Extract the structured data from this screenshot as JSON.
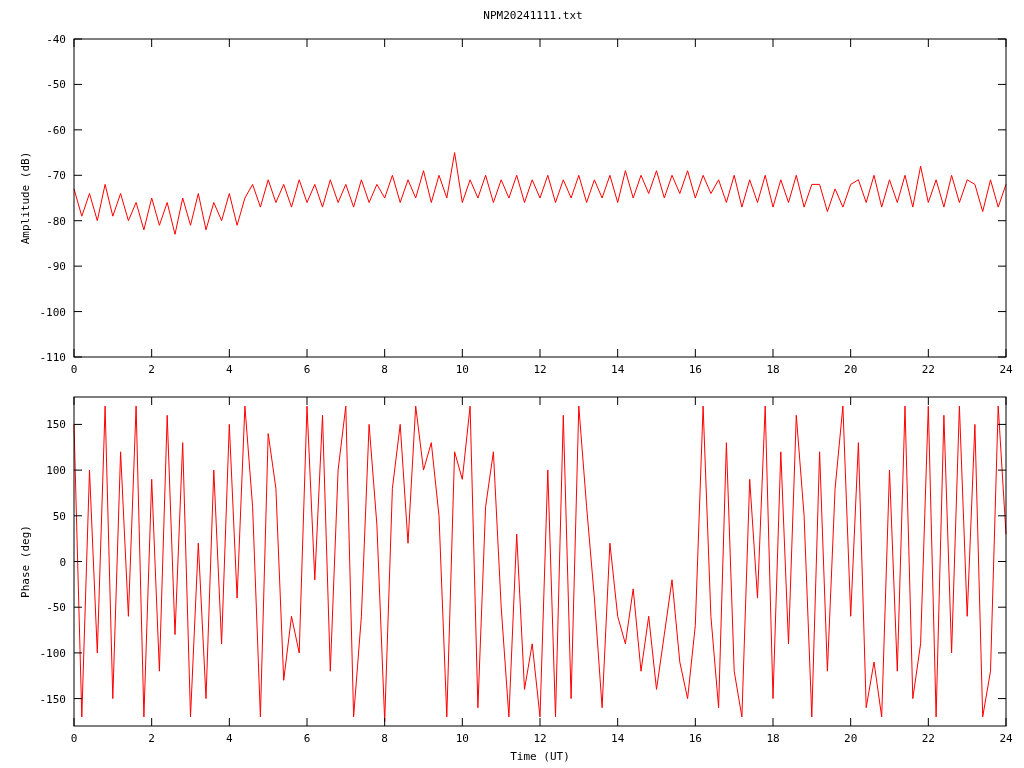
{
  "title": "NPM20241111.txt",
  "amplitude_plot": {
    "chart_data": {
      "type": "line",
      "ylabel": "Amplitude (dB)",
      "xlim": [
        0,
        24
      ],
      "ylim": [
        -110,
        -40
      ],
      "xticks": [
        0,
        2,
        4,
        6,
        8,
        10,
        12,
        14,
        16,
        18,
        20,
        22,
        24
      ],
      "yticks": [
        -110,
        -100,
        -90,
        -80,
        -70,
        -60,
        -50,
        -40
      ],
      "x": [
        0,
        0.2,
        0.4,
        0.6,
        0.8,
        1,
        1.2,
        1.4,
        1.6,
        1.8,
        2,
        2.2,
        2.4,
        2.6,
        2.8,
        3,
        3.2,
        3.4,
        3.6,
        3.8,
        4,
        4.2,
        4.4,
        4.6,
        4.8,
        5,
        5.2,
        5.4,
        5.6,
        5.8,
        6,
        6.2,
        6.4,
        6.6,
        6.8,
        7,
        7.2,
        7.4,
        7.6,
        7.8,
        8,
        8.2,
        8.4,
        8.6,
        8.8,
        9,
        9.2,
        9.4,
        9.6,
        9.8,
        10,
        10.2,
        10.4,
        10.6,
        10.8,
        11,
        11.2,
        11.4,
        11.6,
        11.8,
        12,
        12.2,
        12.4,
        12.6,
        12.8,
        13,
        13.2,
        13.4,
        13.6,
        13.8,
        14,
        14.2,
        14.4,
        14.6,
        14.8,
        15,
        15.2,
        15.4,
        15.6,
        15.8,
        16,
        16.2,
        16.4,
        16.6,
        16.8,
        17,
        17.2,
        17.4,
        17.6,
        17.8,
        18,
        18.2,
        18.4,
        18.6,
        18.8,
        19,
        19.2,
        19.4,
        19.6,
        19.8,
        20,
        20.2,
        20.4,
        20.6,
        20.8,
        21,
        21.2,
        21.4,
        21.6,
        21.8,
        22,
        22.2,
        22.4,
        22.6,
        22.8,
        23,
        23.2,
        23.4,
        23.6,
        23.8,
        24
      ],
      "series": [
        {
          "color": "#ff0000",
          "values": [
            -73,
            -79,
            -74,
            -80,
            -72,
            -79,
            -74,
            -80,
            -76,
            -82,
            -75,
            -81,
            -76,
            -83,
            -75,
            -81,
            -74,
            -82,
            -76,
            -80,
            -74,
            -81,
            -75,
            -72,
            -77,
            -71,
            -76,
            -72,
            -77,
            -71,
            -76,
            -72,
            -77,
            -71,
            -76,
            -72,
            -77,
            -71,
            -76,
            -72,
            -75,
            -70,
            -76,
            -71,
            -75,
            -69,
            -76,
            -70,
            -75,
            -65,
            -76,
            -71,
            -75,
            -70,
            -76,
            -71,
            -75,
            -70,
            -76,
            -71,
            -75,
            -70,
            -76,
            -71,
            -75,
            -70,
            -76,
            -71,
            -75,
            -70,
            -76,
            -69,
            -75,
            -70,
            -74,
            -69,
            -75,
            -70,
            -74,
            -69,
            -75,
            -70,
            -74,
            -71,
            -76,
            -70,
            -77,
            -71,
            -76,
            -70,
            -77,
            -71,
            -76,
            -70,
            -77,
            -72,
            -72,
            -78,
            -73,
            -77,
            -72,
            -71,
            -76,
            -70,
            -77,
            -71,
            -76,
            -70,
            -77,
            -68,
            -76,
            -71,
            -77,
            -70,
            -76,
            -71,
            -72,
            -78,
            -71,
            -77,
            -72
          ]
        }
      ]
    }
  },
  "phase_plot": {
    "chart_data": {
      "type": "line",
      "xlabel": "Time (UT)",
      "ylabel": "Phase (deg)",
      "xlim": [
        0,
        24
      ],
      "ylim": [
        -180,
        180
      ],
      "xticks": [
        0,
        2,
        4,
        6,
        8,
        10,
        12,
        14,
        16,
        18,
        20,
        22,
        24
      ],
      "yticks": [
        -150,
        -100,
        -50,
        0,
        50,
        100,
        150
      ],
      "x": [
        0,
        0.2,
        0.4,
        0.6,
        0.8,
        1,
        1.2,
        1.4,
        1.6,
        1.8,
        2,
        2.2,
        2.4,
        2.6,
        2.8,
        3,
        3.2,
        3.4,
        3.6,
        3.8,
        4,
        4.2,
        4.4,
        4.6,
        4.8,
        5,
        5.2,
        5.4,
        5.6,
        5.8,
        6,
        6.2,
        6.4,
        6.6,
        6.8,
        7,
        7.2,
        7.4,
        7.6,
        7.8,
        8,
        8.2,
        8.4,
        8.6,
        8.8,
        9,
        9.2,
        9.4,
        9.6,
        9.8,
        10,
        10.2,
        10.4,
        10.6,
        10.8,
        11,
        11.2,
        11.4,
        11.6,
        11.8,
        12,
        12.2,
        12.4,
        12.6,
        12.8,
        13,
        13.2,
        13.4,
        13.6,
        13.8,
        14,
        14.2,
        14.4,
        14.6,
        14.8,
        15,
        15.2,
        15.4,
        15.6,
        15.8,
        16,
        16.2,
        16.4,
        16.6,
        16.8,
        17,
        17.2,
        17.4,
        17.6,
        17.8,
        18,
        18.2,
        18.4,
        18.6,
        18.8,
        19,
        19.2,
        19.4,
        19.6,
        19.8,
        20,
        20.2,
        20.4,
        20.6,
        20.8,
        21,
        21.2,
        21.4,
        21.6,
        21.8,
        22,
        22.2,
        22.4,
        22.6,
        22.8,
        23,
        23.2,
        23.4,
        23.6,
        23.8,
        24
      ],
      "series": [
        {
          "color": "#ff0000",
          "values": [
            150,
            -170,
            100,
            -100,
            170,
            -150,
            120,
            -60,
            170,
            -170,
            90,
            -120,
            160,
            -80,
            130,
            -170,
            20,
            -150,
            100,
            -90,
            150,
            -40,
            170,
            60,
            -170,
            140,
            80,
            -130,
            -60,
            -100,
            170,
            -20,
            160,
            -120,
            100,
            170,
            -170,
            -60,
            150,
            40,
            -175,
            80,
            150,
            20,
            170,
            100,
            130,
            50,
            -170,
            120,
            90,
            170,
            -160,
            60,
            120,
            -50,
            -170,
            30,
            -140,
            -90,
            -170,
            100,
            -170,
            160,
            -150,
            170,
            60,
            -40,
            -160,
            20,
            -60,
            -90,
            -30,
            -120,
            -60,
            -140,
            -80,
            -20,
            -110,
            -150,
            -70,
            170,
            -60,
            -160,
            130,
            -120,
            -170,
            90,
            -40,
            170,
            -150,
            120,
            -90,
            160,
            50,
            -170,
            120,
            -120,
            80,
            170,
            -60,
            130,
            -160,
            -110,
            -170,
            100,
            -120,
            170,
            -150,
            -90,
            170,
            -170,
            160,
            -100,
            170,
            -60,
            150,
            -170,
            -120,
            170,
            30
          ]
        }
      ]
    }
  }
}
